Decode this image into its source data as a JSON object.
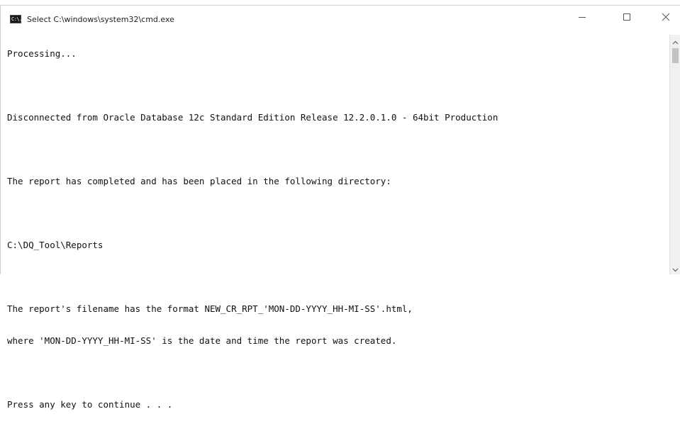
{
  "window": {
    "title": "Select C:\\windows\\system32\\cmd.exe",
    "icon_label": "C:\\."
  },
  "controls": {
    "minimize": "minimize-icon",
    "maximize": "maximize-icon",
    "close": "close-icon"
  },
  "console": {
    "lines": [
      "",
      "Processing...",
      "",
      "Disconnected from Oracle Database 12c Standard Edition Release 12.2.0.1.0 - 64bit Production",
      "",
      "The report has completed and has been placed in the following directory:",
      "",
      "C:\\DQ_Tool\\Reports",
      "",
      "The report's filename has the format NEW_CR_RPT_'MON-DD-YYYY_HH-MI-SS'.html,",
      "where 'MON-DD-YYYY_HH-MI-SS' is the date and time the report was created.",
      "",
      "Press any key to continue . . ."
    ]
  },
  "colors": {
    "background": "#ffffff",
    "text": "#111111",
    "scrollbar_track": "#f0f0f0",
    "scrollbar_thumb": "#c2c2c2"
  }
}
